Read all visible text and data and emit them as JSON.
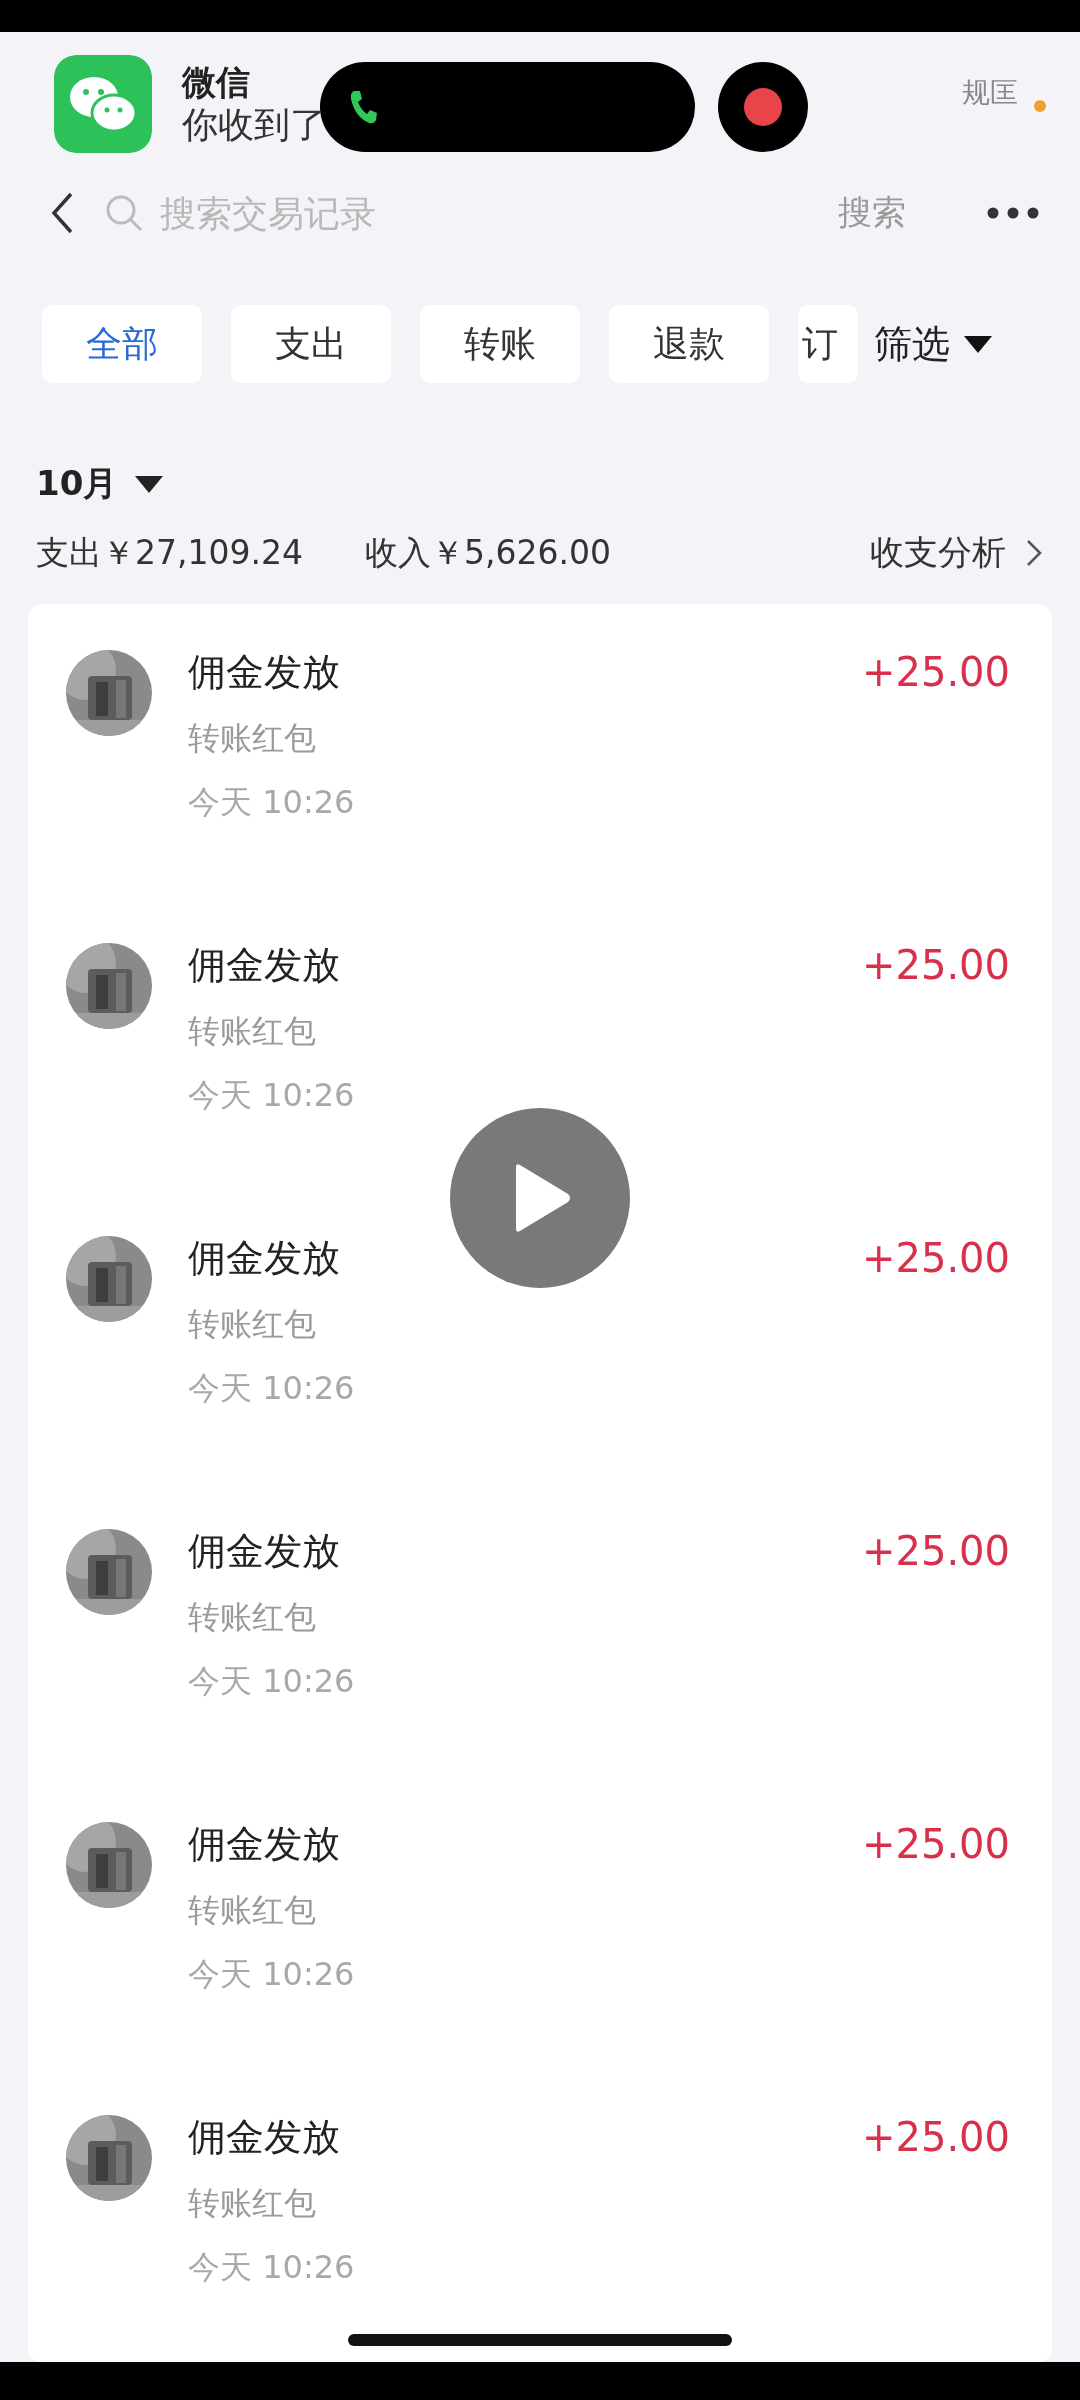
{
  "notification": {
    "app": "微信",
    "text": "你收到了"
  },
  "status_text": "规匡",
  "search": {
    "placeholder": "搜索交易记录",
    "button": "搜索"
  },
  "tabs": [
    {
      "label": "全部",
      "selected": true
    },
    {
      "label": "支出",
      "selected": false
    },
    {
      "label": "转账",
      "selected": false
    },
    {
      "label": "退款",
      "selected": false
    },
    {
      "label": "订",
      "selected": false
    }
  ],
  "filter": "筛选",
  "month": "10月",
  "summary": {
    "expense": "支出￥27,109.24",
    "income": "收入￥5,626.00",
    "analysis": "收支分析"
  },
  "rows": [
    {
      "title": "佣金发放",
      "subtitle": "转账红包",
      "time": "今天 10:26",
      "amount": "+25.00"
    },
    {
      "title": "佣金发放",
      "subtitle": "转账红包",
      "time": "今天 10:26",
      "amount": "+25.00"
    },
    {
      "title": "佣金发放",
      "subtitle": "转账红包",
      "time": "今天 10:26",
      "amount": "+25.00"
    },
    {
      "title": "佣金发放",
      "subtitle": "转账红包",
      "time": "今天 10:26",
      "amount": "+25.00"
    },
    {
      "title": "佣金发放",
      "subtitle": "转账红包",
      "time": "今天 10:26",
      "amount": "+25.00"
    },
    {
      "title": "佣金发放",
      "subtitle": "转账红包",
      "time": "今天 10:26",
      "amount": "+25.00"
    }
  ]
}
